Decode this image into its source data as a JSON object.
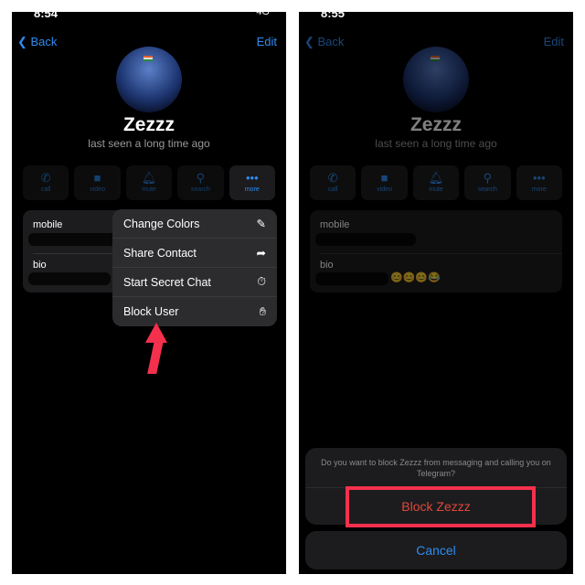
{
  "left": {
    "time": "8:54",
    "status": "4G",
    "back": "Back",
    "edit": "Edit",
    "name": "Zezzz",
    "seen": "last seen a long time ago",
    "actions": [
      {
        "icon": "phone-icon",
        "label": "call"
      },
      {
        "icon": "video-icon",
        "label": "video"
      },
      {
        "icon": "bell-icon",
        "label": "mute"
      },
      {
        "icon": "search-icon",
        "label": "search"
      },
      {
        "icon": "more-icon",
        "label": "more"
      }
    ],
    "mobile_label": "mobile",
    "bio_label": "bio",
    "menu": [
      {
        "label": "Change Colors",
        "icon": "brush-icon"
      },
      {
        "label": "Share Contact",
        "icon": "share-icon"
      },
      {
        "label": "Start Secret Chat",
        "icon": "timer-icon"
      },
      {
        "label": "Block User",
        "icon": "hand-icon"
      }
    ]
  },
  "right": {
    "time": "8:55",
    "back": "Back",
    "edit": "Edit",
    "name": "Zezzz",
    "seen": "last seen a long time ago",
    "mobile_label": "mobile",
    "bio_label": "bio",
    "bio_emojis": "😊😊😊😂",
    "sheet": {
      "question": "Do you want to block Zezzz from messaging and calling you on Telegram?",
      "block": "Block Zezzz",
      "cancel": "Cancel"
    }
  },
  "colors": {
    "accent": "#2f8cf0",
    "destructive": "#e0483c",
    "highlight": "#f5304d"
  }
}
